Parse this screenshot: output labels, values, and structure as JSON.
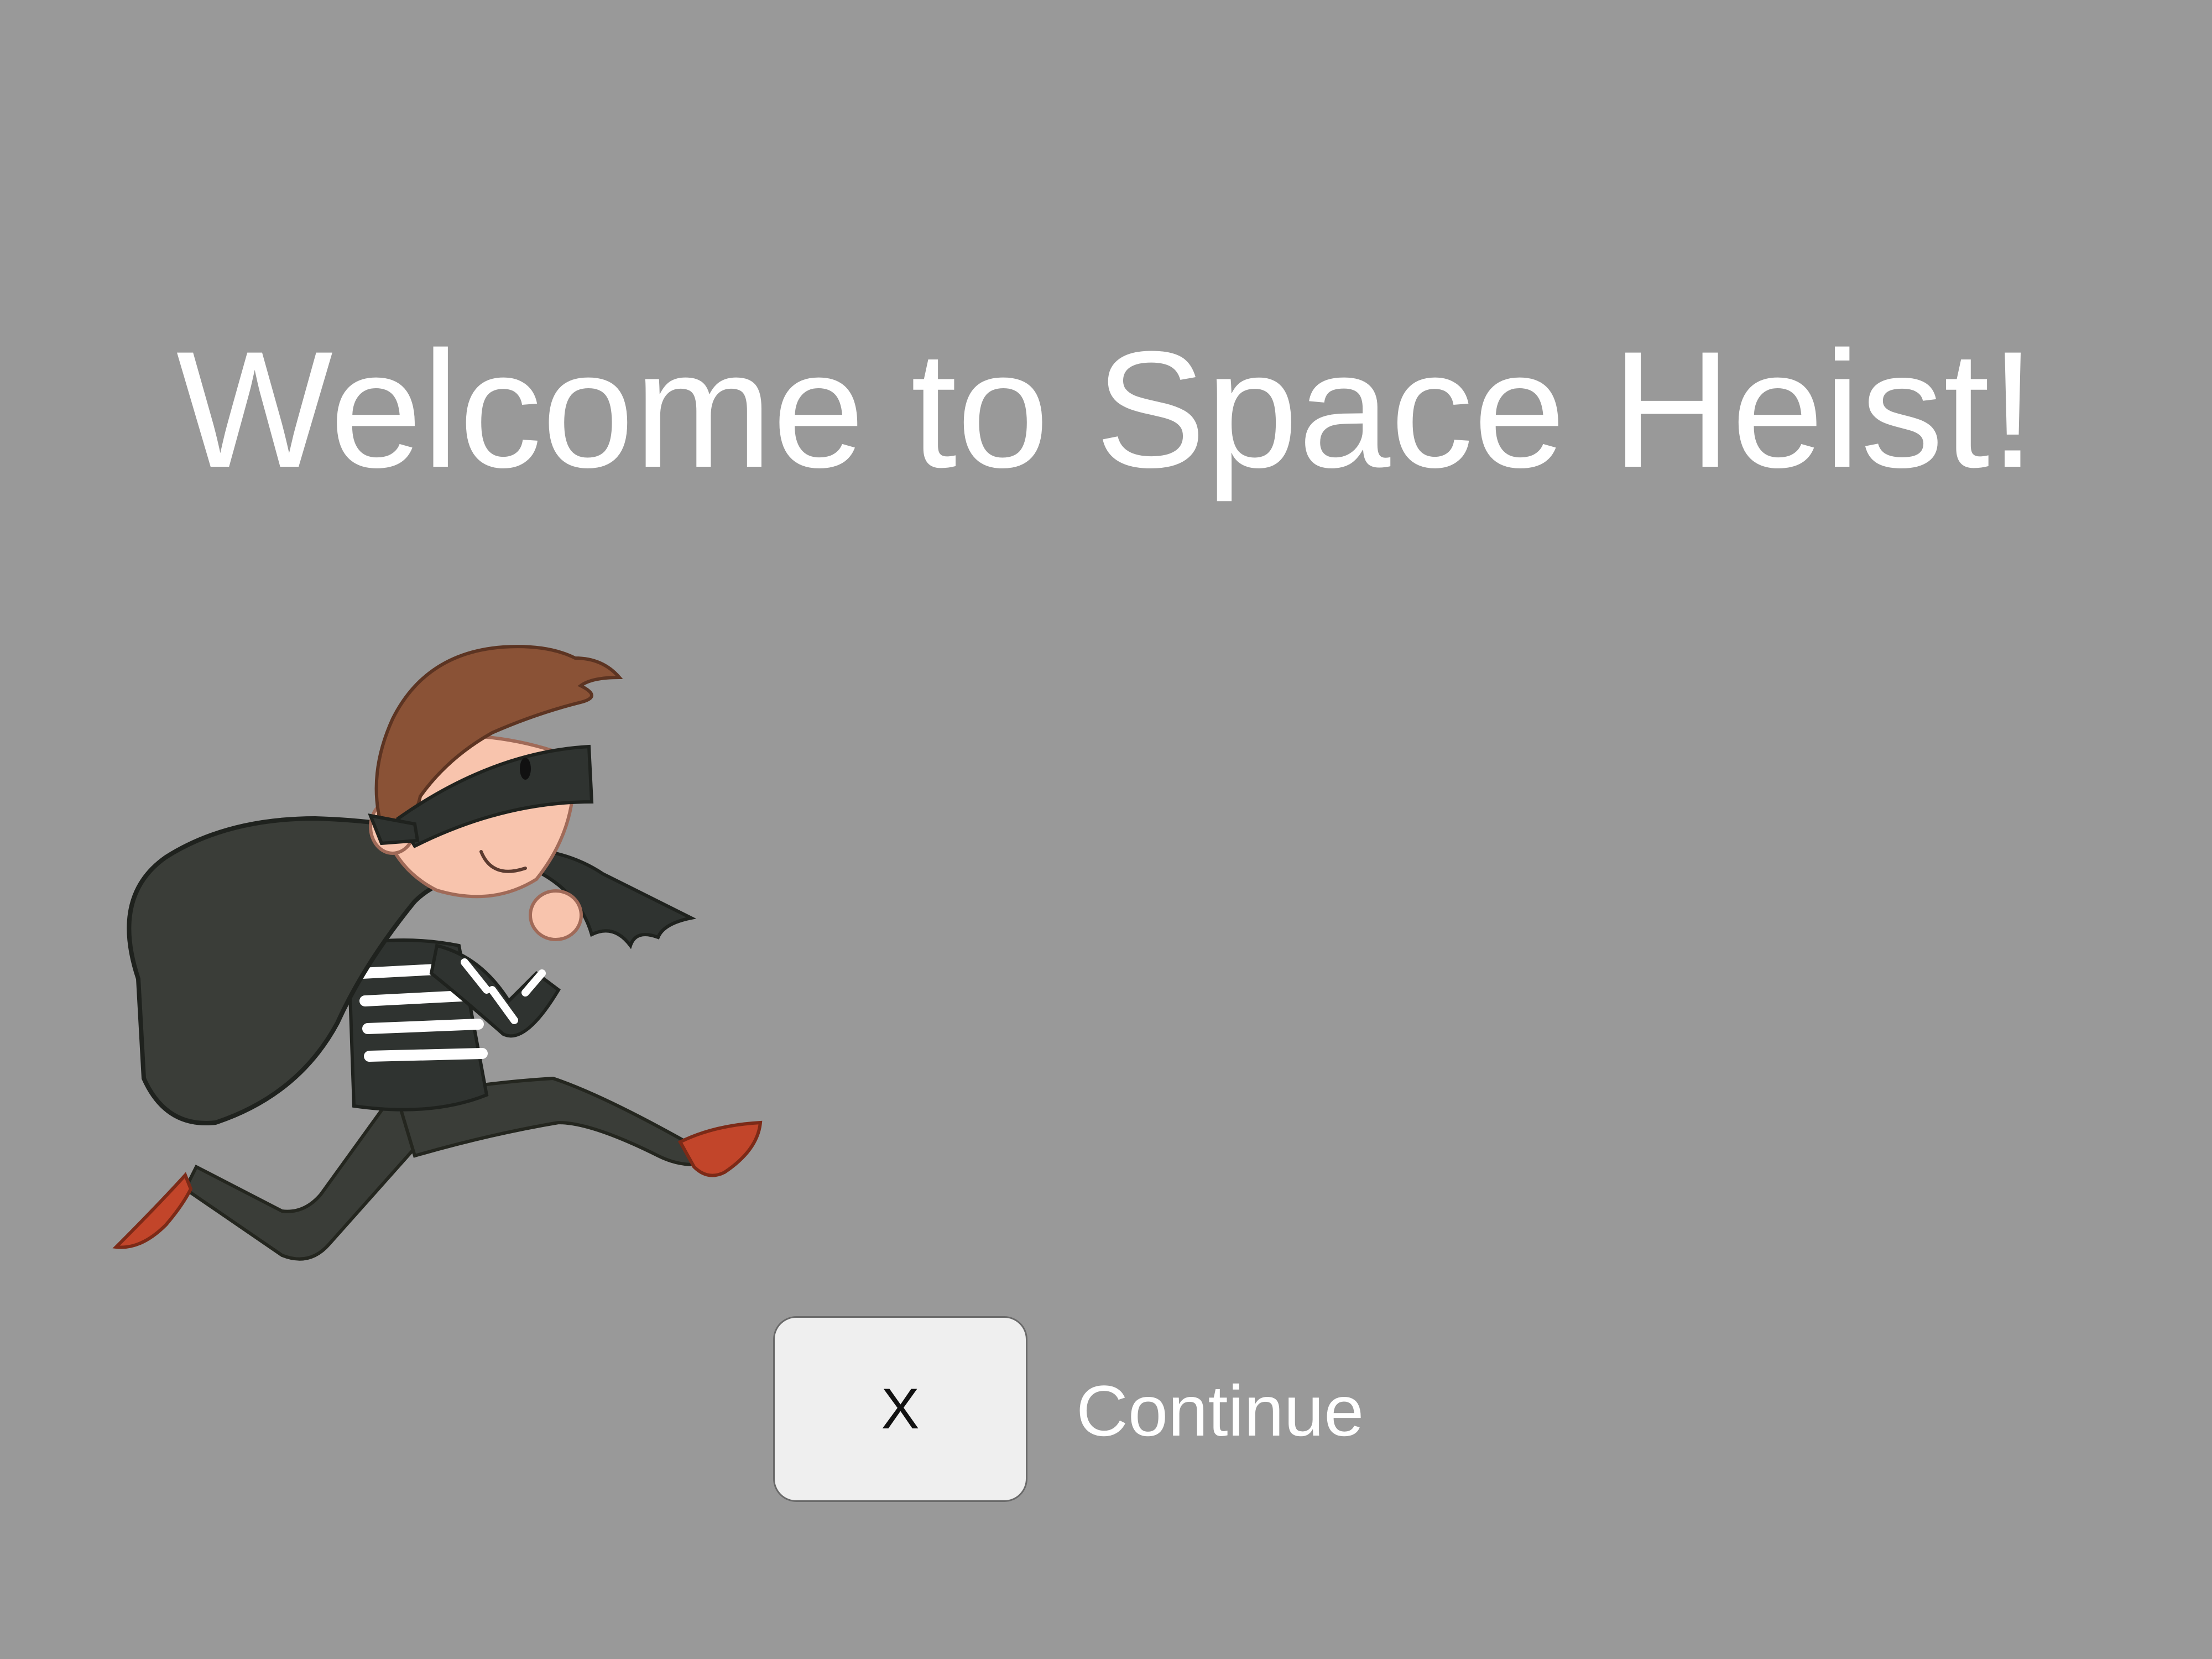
{
  "screen": {
    "title": "Welcome to Space Heist!",
    "background_color": "#999999"
  },
  "illustration": {
    "subject": "thief-carrying-sack",
    "colors": {
      "hair": "#8a5236",
      "skin": "#f8c4ad",
      "mask": "#2f3330",
      "sack": "#3a3d38",
      "shirt_stripe": "#ffffff",
      "shoes": "#c2452a"
    }
  },
  "prompt": {
    "key_label": "X",
    "action_label": "Continue"
  }
}
